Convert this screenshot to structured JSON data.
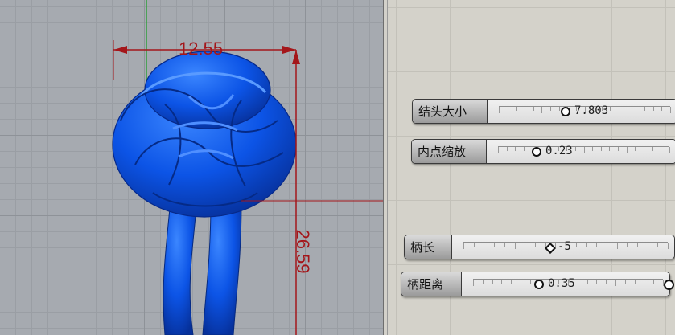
{
  "viewport": {
    "dimension_width": "12.55",
    "dimension_height": "26.59",
    "knot_color": "#0c54e6",
    "dimension_color": "#a4161a"
  },
  "sliders": [
    {
      "name": "结头大小",
      "value": "7.803",
      "fraction": 0.46
    },
    {
      "name": "内点缩放",
      "value": "0.23",
      "fraction": 0.23
    },
    {
      "name": "柄长",
      "value": "-5",
      "fraction": 0.42
    },
    {
      "name": "柄距离",
      "value": "0.35",
      "fraction": 0.35
    }
  ]
}
